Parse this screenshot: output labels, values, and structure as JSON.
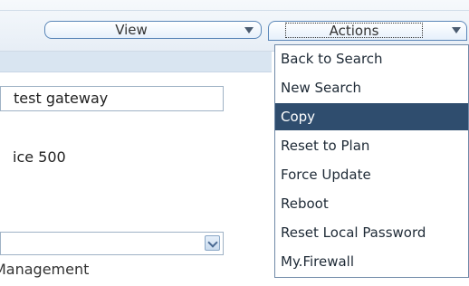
{
  "toolbar": {
    "view_label": "View",
    "actions_label": "Actions"
  },
  "form": {
    "name_value": "test gateway",
    "model_text": "ice 500",
    "select_value": "",
    "management_label": "Management"
  },
  "actions_menu": {
    "items": [
      {
        "label": "Back to Search",
        "selected": false
      },
      {
        "label": "New Search",
        "selected": false
      },
      {
        "label": "Copy",
        "selected": true
      },
      {
        "label": "Reset to Plan",
        "selected": false
      },
      {
        "label": "Force Update",
        "selected": false
      },
      {
        "label": "Reboot",
        "selected": false
      },
      {
        "label": "Reset Local Password",
        "selected": false
      },
      {
        "label": "My.Firewall",
        "selected": false
      }
    ]
  },
  "colors": {
    "selected_bg": "#2f4d6e",
    "button_border": "#5a86b8"
  },
  "icons": {
    "view_dropdown": "chevron-down-icon",
    "actions_dropdown": "chevron-down-icon",
    "select_dropdown": "chevron-down-icon",
    "corner": "note-icon"
  }
}
